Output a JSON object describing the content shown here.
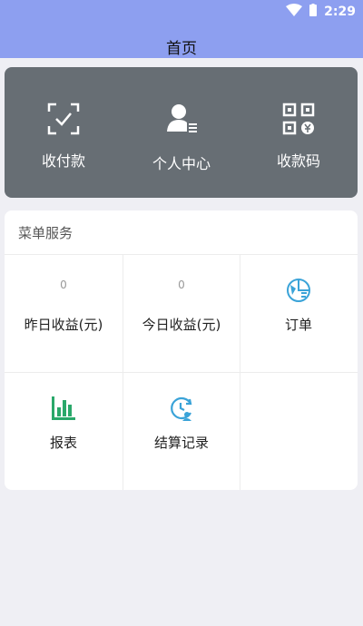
{
  "status_bar": {
    "time": "2:29",
    "wifi_icon": "wifi-icon",
    "battery_icon": "battery-icon"
  },
  "header": {
    "title": "首页"
  },
  "quick_actions": [
    {
      "label": "收付款",
      "icon": "scan-icon"
    },
    {
      "label": "个人中心",
      "icon": "user-center-icon"
    },
    {
      "label": "收款码",
      "icon": "qrcode-icon"
    }
  ],
  "menu": {
    "title": "菜单服务",
    "yesterday": {
      "value": "0",
      "label": "昨日收益(元)"
    },
    "today": {
      "value": "0",
      "label": "今日收益(元)"
    },
    "orders": {
      "label": "订单",
      "icon": "order-icon"
    },
    "reports": {
      "label": "报表",
      "icon": "bar-chart-icon"
    },
    "settlement": {
      "label": "结算记录",
      "icon": "settlement-clock-icon"
    }
  },
  "colors": {
    "header": "#8d9ff0",
    "panel": "#676e74",
    "accent_blue": "#3aa3d8",
    "accent_green": "#2aa86a"
  }
}
